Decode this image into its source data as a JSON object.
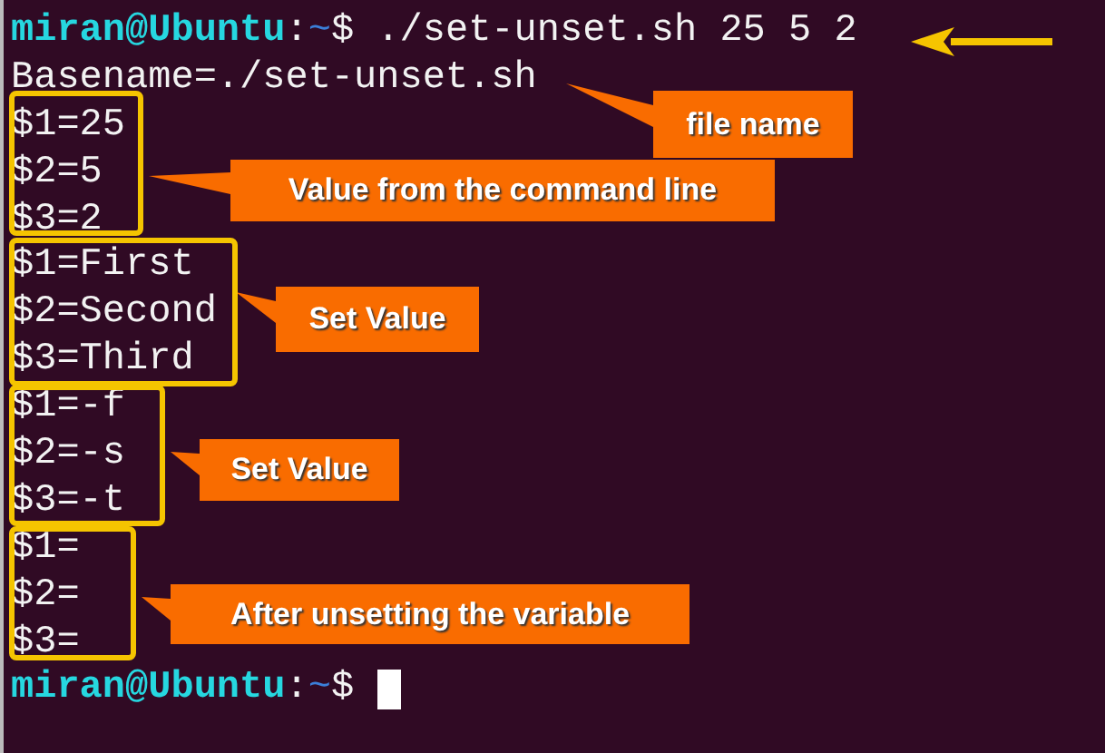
{
  "terminal": {
    "lines": [
      {
        "kind": "prompt",
        "user_host": "miran@Ubuntu",
        "separator": ":",
        "path": "~",
        "symbol": "$",
        "command": "./set-unset.sh 25 5 2"
      },
      {
        "kind": "output",
        "text": "Basename=./set-unset.sh"
      },
      {
        "kind": "output",
        "text": "$1=25"
      },
      {
        "kind": "output",
        "text": "$2=5"
      },
      {
        "kind": "output",
        "text": "$3=2"
      },
      {
        "kind": "output",
        "text": "$1=First"
      },
      {
        "kind": "output",
        "text": "$2=Second"
      },
      {
        "kind": "output",
        "text": "$3=Third"
      },
      {
        "kind": "output",
        "text": "$1=-f"
      },
      {
        "kind": "output",
        "text": "$2=-s"
      },
      {
        "kind": "output",
        "text": "$3=-t"
      },
      {
        "kind": "output",
        "text": "$1="
      },
      {
        "kind": "output",
        "text": "$2="
      },
      {
        "kind": "output",
        "text": "$3="
      },
      {
        "kind": "prompt",
        "user_host": "miran@Ubuntu",
        "separator": ":",
        "path": "~",
        "symbol": "$",
        "cursor": true
      }
    ]
  },
  "callouts": [
    {
      "label": "file name"
    },
    {
      "label": "Value from the command line"
    },
    {
      "label": "Set Value"
    },
    {
      "label": "Set Value"
    },
    {
      "label": "After unsetting the variable"
    }
  ]
}
